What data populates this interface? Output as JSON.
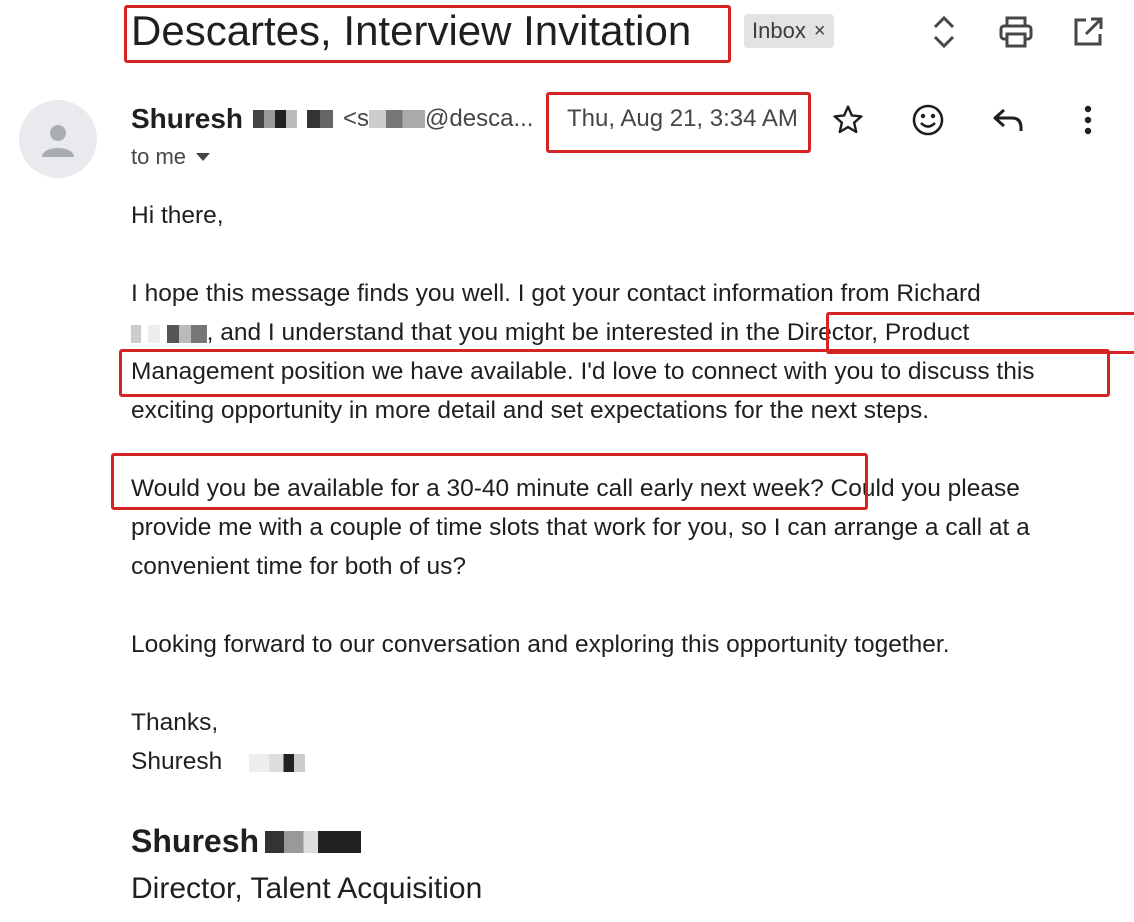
{
  "email": {
    "subject": "Descartes, Interview Invitation",
    "label_chip": "Inbox",
    "label_chip_close": "×",
    "sender_first_name": "Shuresh",
    "sender_email_start": "<s",
    "sender_email_domain": "@desca...",
    "date": "Thu, Aug 21, 3:34 AM",
    "recipient": "to me",
    "greeting": "Hi there,",
    "para1_part1": "I hope this message finds you well. I got your contact information from Richard",
    "para1_part2": ", and I understand that you might be interested in the ",
    "para1_part3": "Director, Product",
    "para1_part4": "Management position we have available. I'd love to connect with you to discuss this",
    "para1_part5": "exciting opportunity in more detail and set expectations for the next steps.",
    "para2_part1": "Would you be available for a 30-40 minute call early next week?",
    "para2_part2": " Could you please provide me with a couple of time slots that work for you, so I can arrange a call at a convenient time for both of us?",
    "para3": "Looking forward to our conversation and exploring this opportunity together.",
    "closing": "Thanks,",
    "closing_name": "Shuresh",
    "signature_name": "Shuresh",
    "signature_title": "Director, Talent Acquisition"
  },
  "icons": {
    "nav": "unfold-icon",
    "print": "print-icon",
    "open_new": "open-in-new-icon",
    "star": "star-icon",
    "emoji": "emoji-icon",
    "reply": "reply-icon",
    "more": "more-vert-icon",
    "avatar": "person-icon",
    "dropdown": "caret-down-icon"
  },
  "colors": {
    "highlight_box": "#d62323",
    "chip_bg": "#e3e3e3",
    "secondary_text": "#444746"
  }
}
